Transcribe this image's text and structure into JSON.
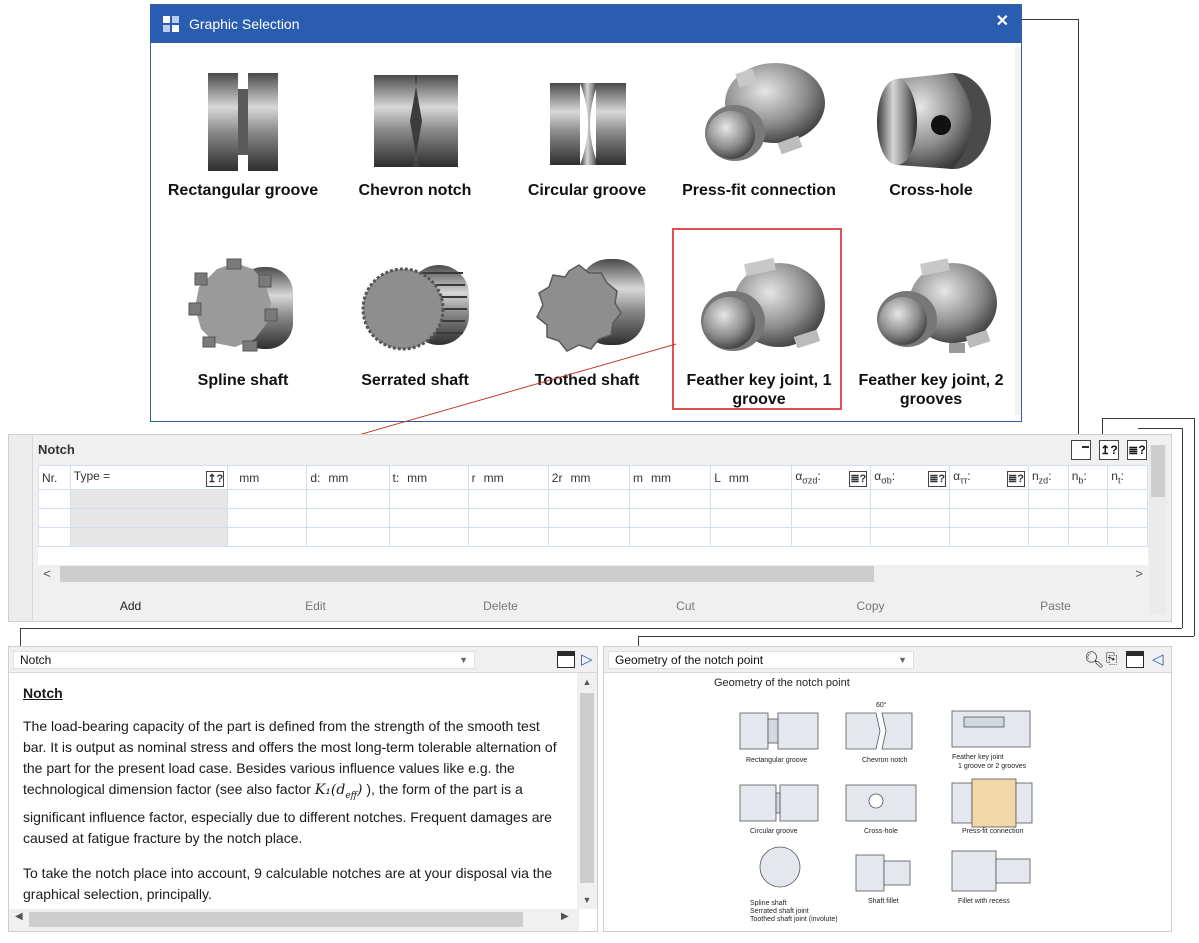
{
  "dialog": {
    "title": "Graphic Selection",
    "close_glyph": "✕",
    "tiles": [
      {
        "label": "Rectangular groove",
        "shape": "rect-groove"
      },
      {
        "label": "Chevron notch",
        "shape": "chevron"
      },
      {
        "label": "Circular groove",
        "shape": "circular"
      },
      {
        "label": "Press-fit connection",
        "shape": "pressfit"
      },
      {
        "label": "Cross-hole",
        "shape": "crosshole"
      },
      {
        "label": "Spline shaft",
        "shape": "spline"
      },
      {
        "label": "Serrated shaft",
        "shape": "serrated"
      },
      {
        "label": "Toothed shaft",
        "shape": "toothed"
      },
      {
        "label": "Feather key joint, 1 groove",
        "shape": "key1",
        "selected": true
      },
      {
        "label": "Feather key joint, 2 grooves",
        "shape": "key2"
      }
    ]
  },
  "notch_panel": {
    "title": "Notch",
    "icons": [
      "graphic-selection-icon",
      "edit-type-icon",
      "help-list-icon"
    ],
    "columns": {
      "nr": "Nr.",
      "type": "Type =",
      "unit": "mm",
      "d": "d:",
      "t": "t:",
      "r": "r",
      "two_r": "2r",
      "m": "m",
      "L": "L",
      "alpha_zd": "α",
      "alpha_zd_sub": "σzd",
      "alpha_b": "α",
      "alpha_b_sub": "σb",
      "alpha_t": "α",
      "alpha_t_sub": "ττ",
      "n_zd": "n",
      "n_zd_sub": "zd",
      "n_b": "n",
      "n_b_sub": "b",
      "n_t": "n",
      "n_t_sub": "t",
      "colon": ":",
      "help_glyph": "≣?",
      "edit_glyph": "↥?"
    },
    "buttons": {
      "add": "Add",
      "edit": "Edit",
      "delete": "Delete",
      "cut": "Cut",
      "copy": "Copy",
      "paste": "Paste"
    },
    "scroll_left": "<",
    "scroll_right": ">"
  },
  "help_panel": {
    "combo": "Notch",
    "heading": "Notch",
    "para1_a": "The load-bearing capacity of the part is defined from the strength of the smooth test bar. It is output as nominal stress and offers the most long-term tolerable alternation of the part for the present load case. Besides various influence values like e.g. the technological dimension factor (see also factor ",
    "para1_math": "K₁(d",
    "para1_math_sub": "eff",
    "para1_math_end": ")",
    "para1_b": " ), the form of the part is a significant influence factor, especially due to different notches. Frequent damages are caused at fatigue fracture by the notch place.",
    "para2": "To take the notch place into account, 9 calculable notches are at your disposal via the graphical selection, principally."
  },
  "geo_panel": {
    "combo": "Geometry of the notch point",
    "caption": "Geometry of the notch point",
    "labels": {
      "rect": "Rectangular groove",
      "chevron": "Chevron notch",
      "key": "Feather key joint",
      "key2": "1 groove or 2 grooves",
      "circular": "Circular groove",
      "cross": "Cross-hole",
      "pressfit": "Press-fit connection",
      "spline1": "Spline shaft",
      "spline2": "Serrated shaft joint",
      "spline3": "Toothed shaft joint (involute)",
      "fillet": "Shaft fillet",
      "recess": "Fillet with recess",
      "deg": "60°"
    }
  },
  "colors": {
    "title_bar": "#2a5db0",
    "selection": "#e05252",
    "connector": "#c0392b"
  }
}
